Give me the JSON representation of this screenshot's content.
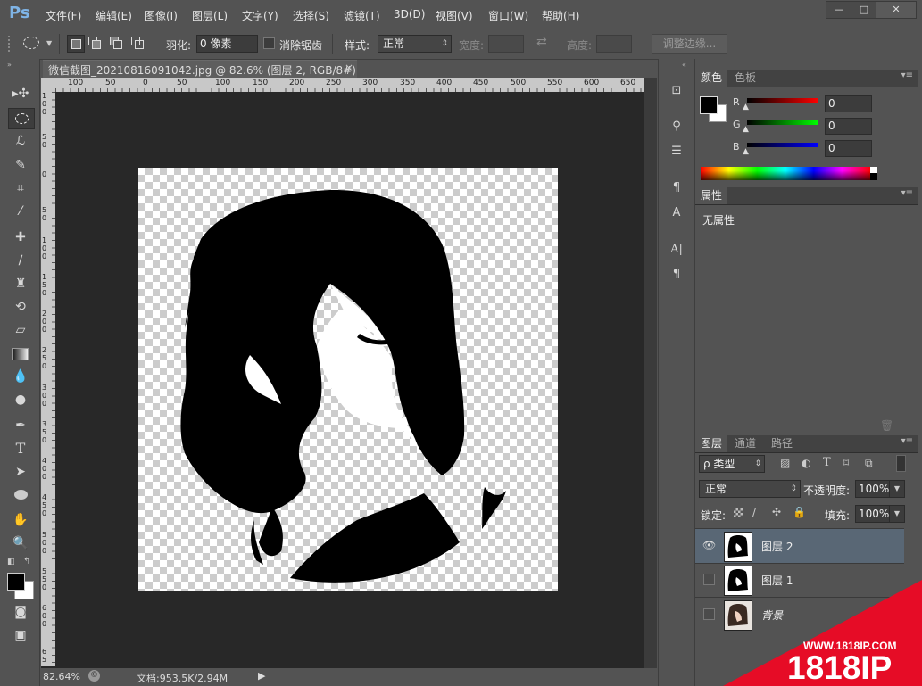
{
  "app": {
    "logo": "Ps"
  },
  "menu": [
    "文件(F)",
    "编辑(E)",
    "图像(I)",
    "图层(L)",
    "文字(Y)",
    "选择(S)",
    "滤镜(T)",
    "3D(D)",
    "视图(V)",
    "窗口(W)",
    "帮助(H)"
  ],
  "window_controls": {
    "minimize": "—",
    "maximize": "□",
    "close": "✕"
  },
  "options": {
    "feather_label": "羽化:",
    "feather_value": "0 像素",
    "antialias_label": "消除锯齿",
    "style_label": "样式:",
    "style_value": "正常",
    "width_label": "宽度:",
    "height_label": "高度:",
    "refine_button": "调整边缘..."
  },
  "document": {
    "tab_title": "微信截图_20210816091042.jpg @ 82.6% (图层 2, RGB/8#) *",
    "close": "×",
    "ruler_h": [
      "100",
      "50",
      "0",
      "50",
      "100",
      "150",
      "200",
      "250",
      "300",
      "350",
      "400",
      "450",
      "500",
      "550",
      "600",
      "650"
    ],
    "ruler_v": [
      "1 0 0",
      "5 0",
      "0",
      "5 0",
      "1 0 0",
      "1 5 0",
      "2 0 0",
      "2 5 0",
      "3 0 0",
      "3 5 0",
      "4 0 0",
      "4 5 0",
      "5 0 0",
      "5 5 0",
      "6 0 0",
      "6 5"
    ]
  },
  "status": {
    "zoom": "82.64%",
    "doc_info": "文档:953.5K/2.94M"
  },
  "color_panel": {
    "tabs": [
      "颜色",
      "色板"
    ],
    "channels": [
      {
        "label": "R",
        "value": "0",
        "color": "#ff0000"
      },
      {
        "label": "G",
        "value": "0",
        "color": "#00ff00"
      },
      {
        "label": "B",
        "value": "0",
        "color": "#0000ff"
      }
    ]
  },
  "properties_panel": {
    "tab": "属性",
    "empty_text": "无属性"
  },
  "layers_panel": {
    "tabs": [
      "图层",
      "通道",
      "路径"
    ],
    "filter_label": "ρ 类型",
    "blend_mode": "正常",
    "opacity_label": "不透明度:",
    "opacity_value": "100%",
    "lock_label": "锁定:",
    "fill_label": "填充:",
    "fill_value": "100%",
    "layers": [
      {
        "name": "图层 2",
        "visible": true,
        "selected": true
      },
      {
        "name": "图层 1",
        "visible": false,
        "selected": false
      },
      {
        "name": "背景",
        "visible": false,
        "selected": false
      }
    ]
  },
  "watermark": {
    "url": "WWW.1818IP.COM",
    "brand": "1818IP"
  }
}
